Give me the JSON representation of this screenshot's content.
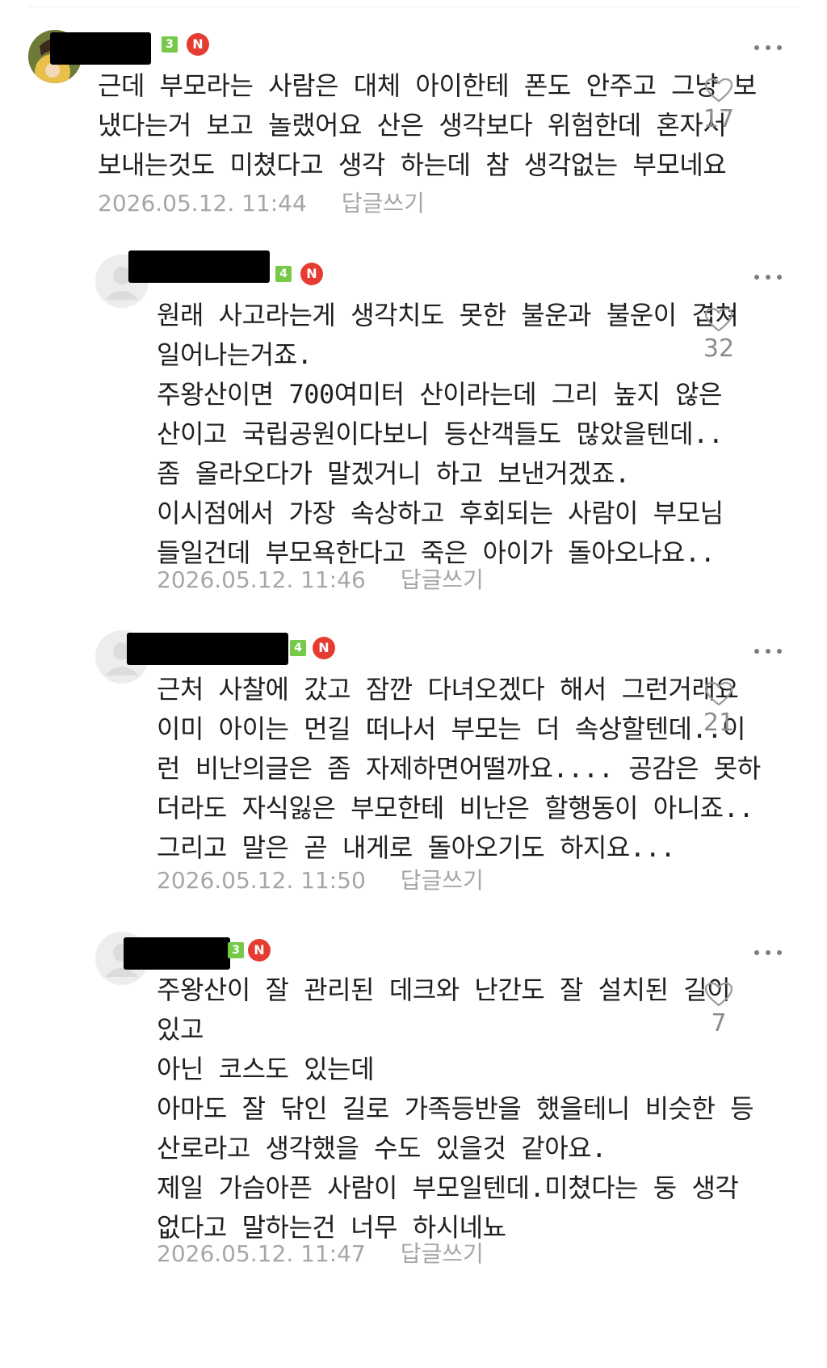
{
  "comments": [
    {
      "level": "3",
      "new_badge": "N",
      "text": "근데 부모라는 사람은 대체 아이한테 폰도 안주고 그냥 보\n냈다는거 보고 놀랬어요 산은 생각보다 위험한데 혼자서\n보내는것도 미쳤다고 생각 하는데 참 생각없는 부모네요",
      "timestamp": "2026.05.12. 11:44",
      "reply_label": "답글쓰기",
      "like_count": "17",
      "avatar": "profile-photo",
      "icons": {
        "like": "heart-icon",
        "menu": "more-dots-icon"
      }
    },
    {
      "level": "4",
      "new_badge": "N",
      "text": "원래 사고라는게 생각치도 못한 불운과 불운이 겹쳐\n일어나는거죠.\n주왕산이면 700여미터 산이라는데 그리 높지 않은\n산이고 국립공원이다보니 등산객들도 많았을텐데..\n좀 올라오다가 말겠거니 하고 보낸거겠죠.\n이시점에서 가장 속상하고 후회되는 사람이 부모님\n들일건데 부모욕한다고 죽은 아이가 돌아오나요..",
      "timestamp": "2026.05.12. 11:46",
      "reply_label": "답글쓰기",
      "like_count": "32",
      "avatar": "default-profile"
    },
    {
      "level": "4",
      "new_badge": "N",
      "text": "근처 사찰에 갔고 잠깐 다녀오겠다 해서 그런거래요\n이미 아이는 먼길 떠나서 부모는 더 속상할텐데..이\n런 비난의글은 좀 자제하면어떨까요.... 공감은 못하\n더라도 자식잃은 부모한테 비난은 할행동이 아니죠..\n그리고 말은 곧 내게로 돌아오기도 하지요...",
      "timestamp": "2026.05.12. 11:50",
      "reply_label": "답글쓰기",
      "like_count": "21",
      "avatar": "default-profile"
    },
    {
      "level": "3",
      "new_badge": "N",
      "text": "주왕산이 잘 관리된 데크와 난간도 잘 설치된 길이\n있고\n아닌 코스도 있는데\n아마도 잘 닦인 길로 가족등반을 했을테니 비슷한 등\n산로라고 생각했을 수도 있을것 같아요.\n제일 가슴아픈 사람이 부모일텐데.미쳤다는 둥 생각\n없다고 말하는건 너무 하시네뇨",
      "timestamp": "2026.05.12. 11:47",
      "reply_label": "답글쓰기",
      "like_count": "7",
      "avatar": "default-profile"
    }
  ]
}
